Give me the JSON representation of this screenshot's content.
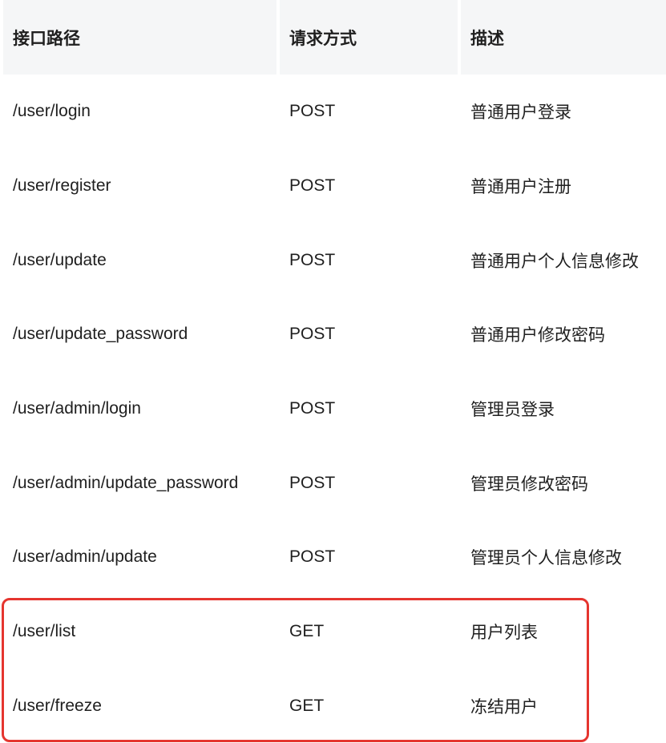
{
  "table": {
    "headers": [
      "接口路径",
      "请求方式",
      "描述"
    ],
    "rows": [
      [
        "/user/login",
        "POST",
        "普通用户登录"
      ],
      [
        "/user/register",
        "POST",
        "普通用户注册"
      ],
      [
        "/user/update",
        "POST",
        "普通用户个人信息修改"
      ],
      [
        "/user/update_password",
        "POST",
        "普通用户修改密码"
      ],
      [
        "/user/admin/login",
        "POST",
        "管理员登录"
      ],
      [
        "/user/admin/update_password",
        "POST",
        "管理员修改密码"
      ],
      [
        "/user/admin/update",
        "POST",
        "管理员个人信息修改"
      ],
      [
        "/user/list",
        "GET",
        "用户列表"
      ],
      [
        "/user/freeze",
        "GET",
        "冻结用户"
      ]
    ]
  },
  "highlight": {
    "color": "#e5352f",
    "rows_highlighted": [
      "/user/list",
      "/user/freeze"
    ]
  }
}
